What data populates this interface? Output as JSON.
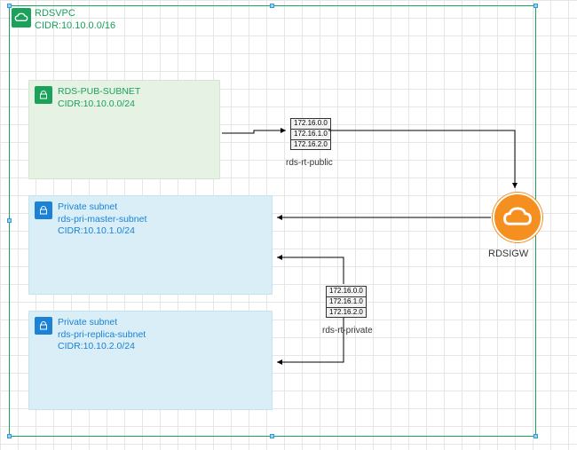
{
  "vpc": {
    "name": "RDSVPC",
    "cidr_label": "CIDR:10.10.0.0/16"
  },
  "subnets": {
    "public": {
      "title": "RDS-PUB-SUBNET",
      "cidr": "CIDR:10.10.0.0/24",
      "icon": "lock-icon"
    },
    "private_master": {
      "title": "Private subnet",
      "name": "rds-pri-master-subnet",
      "cidr": "CIDR:10.10.1.0/24",
      "icon": "lock-icon"
    },
    "private_replica": {
      "title": "Private subnet",
      "name": "rds-pri-replica-subnet",
      "cidr": "CIDR:10.10.2.0/24",
      "icon": "lock-icon"
    }
  },
  "route_tables": {
    "public": {
      "label": "rds-rt-public",
      "rows": [
        "172.16.0.0",
        "172.16.1.0",
        "172.16.2.0"
      ]
    },
    "private": {
      "label": "rds-rt-private",
      "rows": [
        "172.16.0.0",
        "172.16.1.0",
        "172.16.2.0"
      ]
    }
  },
  "igw": {
    "label": "RDSIGW",
    "icon": "cloud-icon"
  },
  "colors": {
    "vpc_green": "#1aa15a",
    "subnet_blue": "#1b82d6",
    "igw_orange": "#f58f20"
  }
}
